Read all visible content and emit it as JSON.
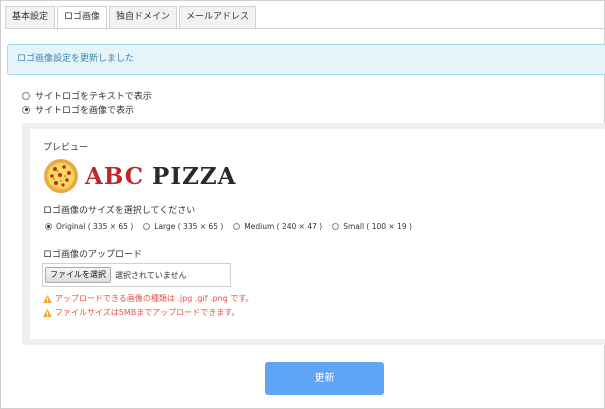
{
  "tabs": [
    {
      "label": "基本設定",
      "active": false
    },
    {
      "label": "ロゴ画像",
      "active": true
    },
    {
      "label": "独自ドメイン",
      "active": false
    },
    {
      "label": "メールアドレス",
      "active": false
    }
  ],
  "alert": {
    "message": "ロゴ画像設定を更新しました"
  },
  "display_mode": {
    "options": [
      {
        "label": "サイトロゴをテキストで表示",
        "checked": false
      },
      {
        "label": "サイトロゴを画像で表示",
        "checked": true
      }
    ]
  },
  "preview": {
    "heading": "プレビュー",
    "logo_word1": "ABC",
    "logo_word2": "PIZZA"
  },
  "size": {
    "heading": "ロゴ画像のサイズを選択してください",
    "options": [
      {
        "label": "Original ( 335 × 65 )",
        "checked": true
      },
      {
        "label": "Large ( 335 × 65 )",
        "checked": false
      },
      {
        "label": "Medium ( 240 × 47 )",
        "checked": false
      },
      {
        "label": "Small ( 100 × 19 )",
        "checked": false
      }
    ]
  },
  "upload": {
    "heading": "ロゴ画像のアップロード",
    "button_label": "ファイルを選択",
    "status": "選択されていません",
    "warnings": [
      "アップロードできる画像の種類は .jpg .gif .png です。",
      "ファイルサイズは5MBまでアップロードできます。"
    ]
  },
  "submit": {
    "label": "更新"
  },
  "colors": {
    "alert_text": "#3a87ad",
    "warning": "#e8504a",
    "primary_button": "#5fa4f5",
    "logo_accent": "#c0272d"
  }
}
